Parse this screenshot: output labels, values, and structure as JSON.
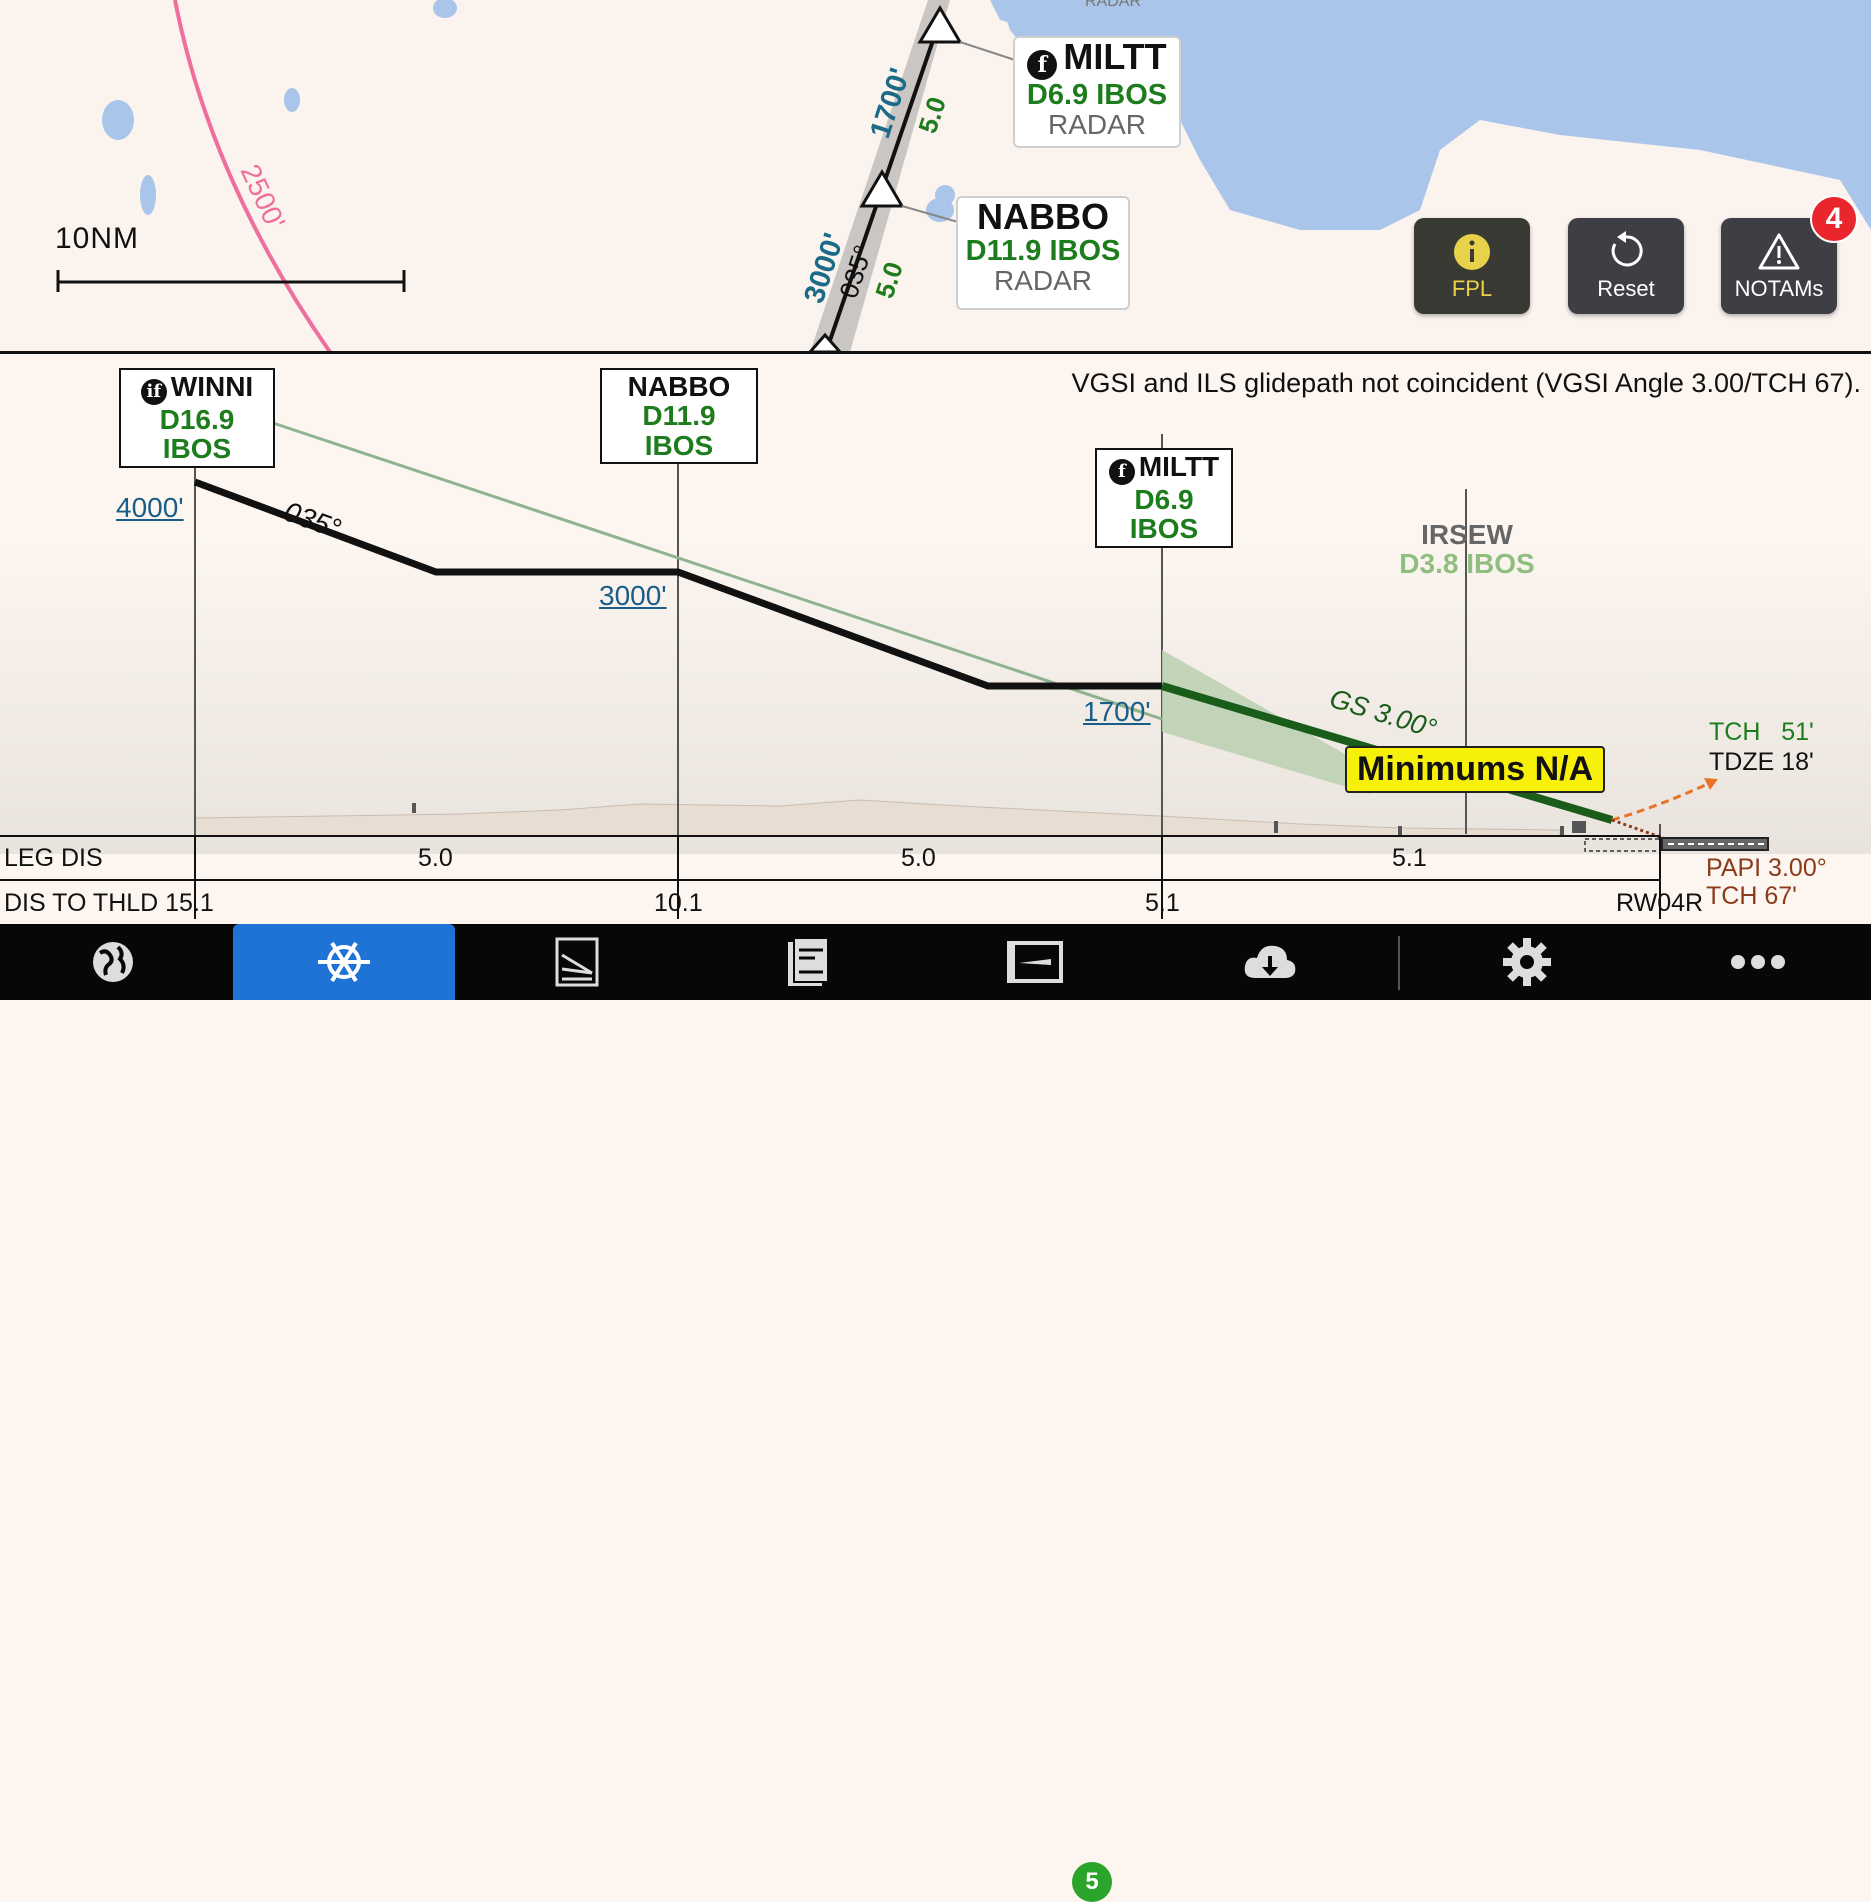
{
  "map": {
    "scale_label": "10NM",
    "radar_top": "RADAR",
    "arc_alt": "2500'",
    "course_alt1": "1700'",
    "course_dist1": "5.0",
    "course_alt2": "3000'",
    "course_heading": "035°",
    "course_dist2": "5.0",
    "fixes": [
      {
        "name": "MILTT",
        "dist": "D6.9 IBOS",
        "radar": "RADAR",
        "icon": "f"
      },
      {
        "name": "NABBO",
        "dist": "D11.9 IBOS",
        "radar": "RADAR"
      }
    ],
    "buttons": {
      "fpl": "FPL",
      "reset": "Reset",
      "notams": "NOTAMs",
      "notams_badge": "4"
    }
  },
  "profile": {
    "note": "VGSI and ILS glidepath not coincident (VGSI Angle 3.00/TCH 67).",
    "fixes": [
      {
        "name": "WINNI",
        "dist": "D16.9 IBOS",
        "icon": "if"
      },
      {
        "name": "NABBO",
        "dist": "D11.9 IBOS"
      },
      {
        "name": "MILTT",
        "dist": "D6.9 IBOS",
        "icon": "f"
      },
      {
        "name": "IRSEW",
        "dist": "D3.8 IBOS"
      }
    ],
    "altitudes": [
      "4000'",
      "3000'",
      "1700'"
    ],
    "heading": "035°",
    "gs_label": "GS 3.00°",
    "minimums": "Minimums N/A",
    "tch": "TCH",
    "tch_val": "51'",
    "tdze": "TDZE",
    "tdze_val": "18'",
    "papi": "PAPI 3.00°",
    "papi_tch": "TCH 67'",
    "leg_dis_label": "LEG DIS",
    "leg_dis": [
      "5.0",
      "5.0",
      "5.1"
    ],
    "dis_thld_label": "DIS TO THLD 15.1",
    "dis_thld": [
      "10.1",
      "5.1"
    ],
    "runway": "RW04R"
  },
  "tabbar": {
    "tabs": [
      "maps-icon",
      "procedures-icon",
      "airport-icon",
      "documents-icon",
      "flights-icon",
      "downloads-icon",
      "settings-icon",
      "more-icon"
    ],
    "flights_badge": "5",
    "colors": {
      "active": "#1f73d6",
      "bar": "#070707"
    }
  }
}
